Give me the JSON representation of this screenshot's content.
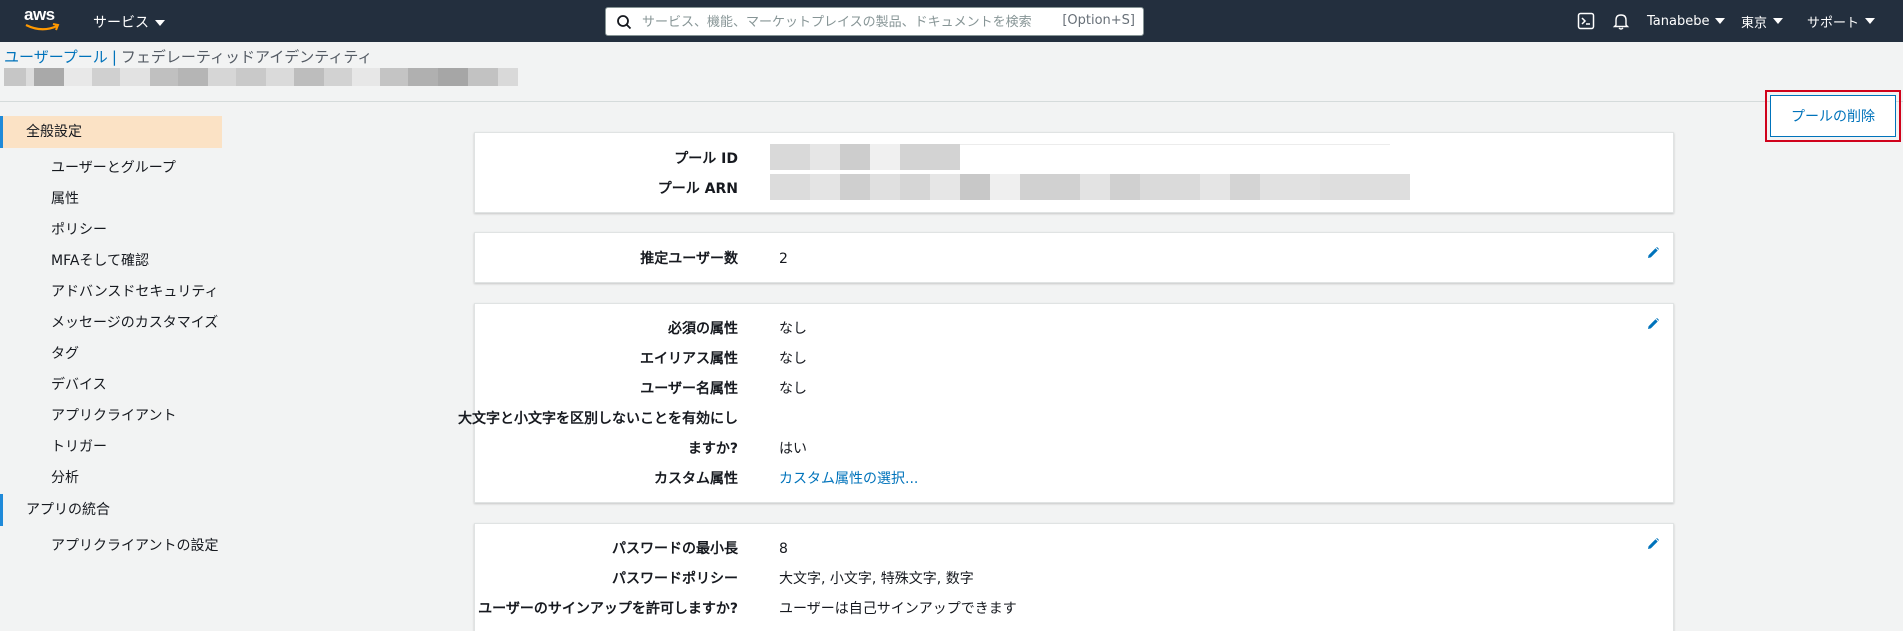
{
  "nav": {
    "logo_text": "aws",
    "services_label": "サービス",
    "search_placeholder": "サービス、機能、マーケットプレイスの製品、ドキュメントを検索",
    "search_shortcut": "[Option+S]",
    "user": "Tanabebe",
    "region": "東京",
    "support": "サポート",
    "icons": [
      "cloudshell-icon",
      "bell-icon"
    ]
  },
  "header": {
    "tab_active": "ユーザープール",
    "tab_separator": "|",
    "tab_inactive": "フェデレーティッドアイデンティティ",
    "delete_button": "プールの削除"
  },
  "sidebar": {
    "sections": [
      {
        "label": "全般設定",
        "active": true,
        "items": [
          "ユーザーとグループ",
          "属性",
          "ポリシー",
          "MFAそして確認",
          "アドバンスドセキュリティ",
          "メッセージのカスタマイズ",
          "タグ",
          "デバイス",
          "アプリクライアント",
          "トリガー",
          "分析"
        ]
      },
      {
        "label": "アプリの統合",
        "active": false,
        "items": [
          "アプリクライアントの設定"
        ]
      }
    ]
  },
  "cards": {
    "pool": {
      "id_label": "プール ID",
      "arn_label": "プール ARN"
    },
    "users": {
      "estimated_label": "推定ユーザー数",
      "estimated_value": "2"
    },
    "attributes": {
      "required_label": "必須の属性",
      "required_value": "なし",
      "alias_label": "エイリアス属性",
      "alias_value": "なし",
      "username_label": "ユーザー名属性",
      "username_value": "なし",
      "case_label_1": "大文字と小文字を区別しないことを有効にし",
      "case_label_2": "ますか?",
      "case_value": "はい",
      "custom_label": "カスタム属性",
      "custom_value": "カスタム属性の選択..."
    },
    "password": {
      "min_label": "パスワードの最小長",
      "min_value": "8",
      "policy_label": "パスワードポリシー",
      "policy_value": "大文字, 小文字, 特殊文字, 数字",
      "signup_label": "ユーザーのサインアップを許可しますか?",
      "signup_value": "ユーザーは自己サインアップできます"
    }
  },
  "colors": {
    "nav_bg": "#232f3e",
    "link": "#0073bb",
    "active_section_bg": "#fbe2c5",
    "highlight_border": "#d0021b"
  }
}
